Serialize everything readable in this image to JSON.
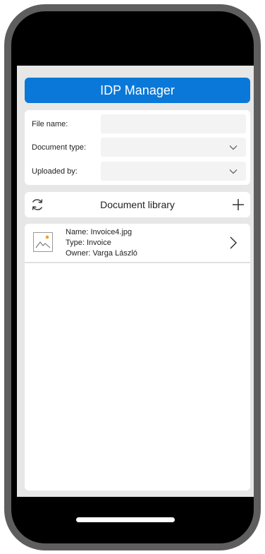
{
  "app": {
    "title": "IDP Manager"
  },
  "filters": {
    "file_name_label": "File name:",
    "file_name_value": "",
    "document_type_label": "Document type:",
    "document_type_value": "",
    "uploaded_by_label": "Uploaded by:",
    "uploaded_by_value": ""
  },
  "library": {
    "title": "Document library"
  },
  "documents": [
    {
      "name": "Name: Invoice4.jpg",
      "type": "Type: Invoice",
      "owner": "Owner: Varga László"
    }
  ],
  "icons": {
    "refresh": "refresh-icon",
    "add": "plus-icon",
    "thumbnail": "image-icon",
    "chevron_down": "chevron-down-icon",
    "chevron_right": "chevron-right-icon"
  },
  "colors": {
    "accent": "#0a78d8",
    "background": "#e7e7e7",
    "thumb_sun": "#f0a12a"
  }
}
